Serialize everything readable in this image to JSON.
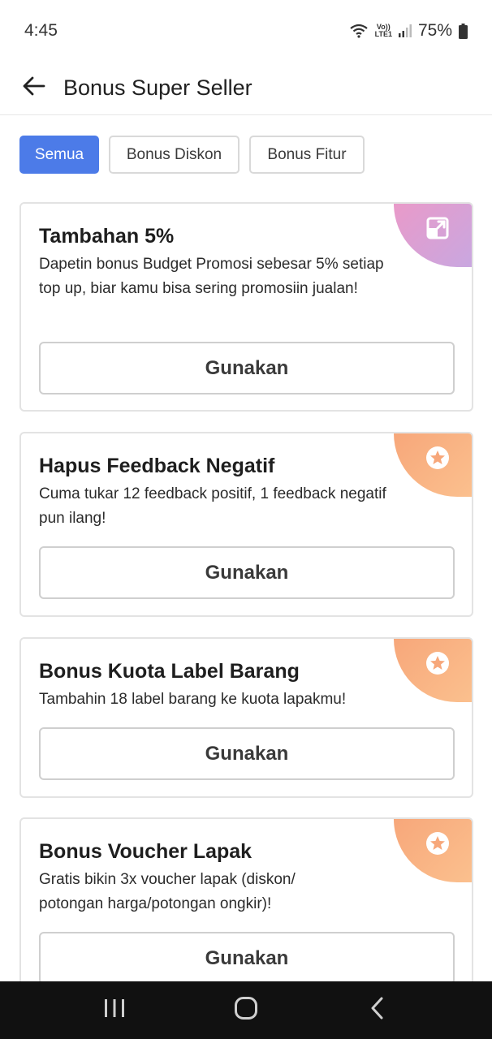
{
  "status_bar": {
    "time": "4:45",
    "lte_top": "Vo))",
    "lte_bottom": "LTE1",
    "battery": "75%"
  },
  "app_bar": {
    "back_icon": "arrow-left-icon",
    "title": "Bonus Super Seller"
  },
  "filters": [
    {
      "label": "Semua",
      "active": true
    },
    {
      "label": "Bonus Diskon",
      "active": false
    },
    {
      "label": "Bonus Fitur",
      "active": false
    }
  ],
  "cards": [
    {
      "title": "Tambahan 5%",
      "description": "Dapetin bonus Budget Promosi sebesar 5% setiap top up, biar kamu bisa sering promosiin jualan!",
      "button": "Gunakan",
      "badge_icon": "external-link-icon",
      "badge_color": "#d9a3d6"
    },
    {
      "title": "Hapus Feedback Negatif",
      "description": "Cuma tukar 12 feedback positif, 1 feedback negatif pun ilang!",
      "button": "Gunakan",
      "badge_icon": "star-icon",
      "badge_color": "#f8b383"
    },
    {
      "title": "Bonus Kuota Label Barang",
      "description": "Tambahin 18 label barang ke kuota lapakmu!",
      "button": "Gunakan",
      "badge_icon": "star-icon",
      "badge_color": "#f8b383"
    },
    {
      "title": "Bonus Voucher Lapak",
      "description": "Gratis bikin 3x voucher lapak (diskon/ potongan harga/potongan ongkir)!",
      "button": "Gunakan",
      "badge_icon": "star-icon",
      "badge_color": "#f8b383"
    }
  ],
  "nav_bar": {
    "recents_icon": "recents-icon",
    "home_icon": "home-icon",
    "back_icon": "back-icon"
  },
  "colors": {
    "primary": "#4c7be8",
    "border": "#e3e3e3",
    "nav_background": "#111111"
  }
}
